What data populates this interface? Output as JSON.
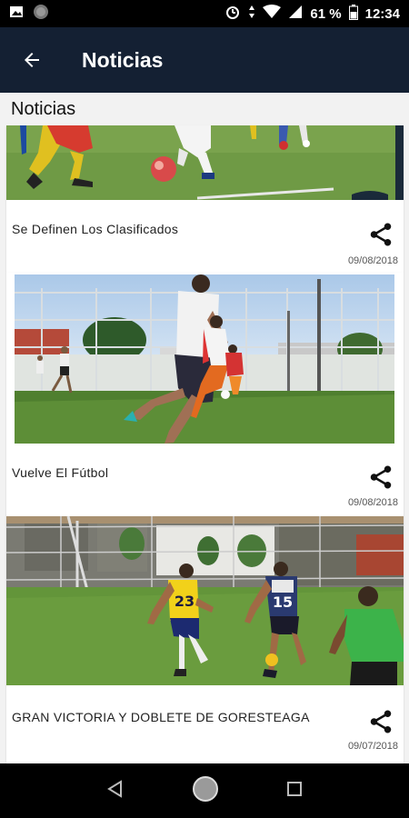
{
  "status_bar": {
    "battery": "61 %",
    "time": "12:34"
  },
  "app_bar": {
    "title": "Noticias"
  },
  "section": {
    "title": "Noticias"
  },
  "articles": [
    {
      "title": "Se Definen Los Clasificados",
      "date": "09/08/2018"
    },
    {
      "title": "Vuelve El Fútbol",
      "date": "09/08/2018"
    },
    {
      "title": "GRAN VICTORIA Y DOBLETE DE GORESTEAGA",
      "date": "09/07/2018"
    }
  ],
  "photo_text": {
    "jersey_1": "23",
    "jersey_2": "15"
  },
  "colors": {
    "app_bar": "#142033",
    "status_bar": "#000000",
    "grass": "#5f8f3a",
    "background": "#f2f2f2"
  }
}
